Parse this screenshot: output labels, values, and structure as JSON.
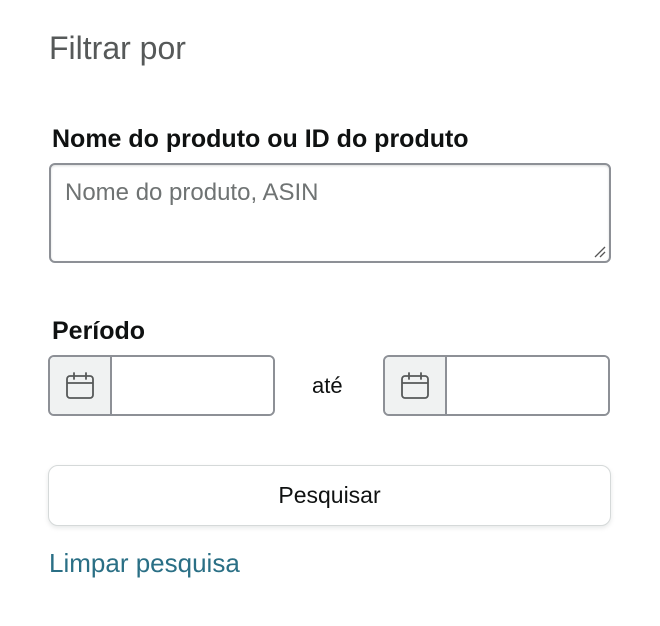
{
  "filter": {
    "heading": "Filtrar por"
  },
  "product_field": {
    "label": "Nome do produto ou ID do produto",
    "placeholder": "Nome do produto, ASIN",
    "value": ""
  },
  "period": {
    "label": "Período",
    "from_value": "",
    "separator": "até",
    "to_value": "",
    "icon": "calendar-icon"
  },
  "actions": {
    "search_label": "Pesquisar",
    "clear_label": "Limpar pesquisa"
  },
  "colors": {
    "link": "#2a6f85",
    "border": "#8d9096",
    "icon_box_bg": "#f0f2f2",
    "heading": "#565959"
  }
}
